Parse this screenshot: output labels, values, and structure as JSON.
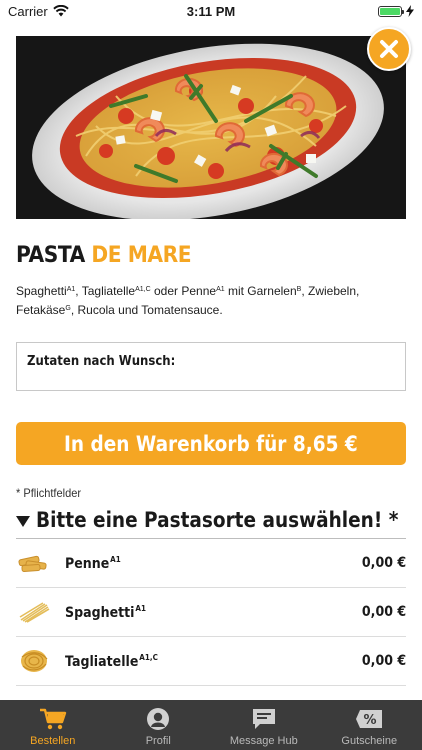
{
  "status_bar": {
    "carrier": "Carrier",
    "time": "3:11 PM"
  },
  "product": {
    "title_main": "PASTA ",
    "title_accent": "DE MARE",
    "desc": {
      "t1": "Spaghetti",
      "s1": "A1",
      "t2": ", Tagliatelle",
      "s2": "A1,C",
      "t3": " oder Penne",
      "s3": "A1",
      "t4": " mit Garnelen",
      "s4": "B",
      "t5": ", Zwiebeln, Fetakäse",
      "s5": "G",
      "t6": ", Rucola und Tomatensauce."
    }
  },
  "wishes_label": "Zutaten nach Wunsch:",
  "cart_button": "In den Warenkorb für 8,65 €",
  "required_note": "* Pflichtfelder",
  "section_title": "Bitte eine Pastasorte auswählen! *",
  "options": [
    {
      "name": "Penne",
      "allergen": "A1",
      "price": "0,00 €"
    },
    {
      "name": "Spaghetti",
      "allergen": "A1",
      "price": "0,00 €"
    },
    {
      "name": "Tagliatelle",
      "allergen": "A1,C",
      "price": "0,00 €"
    }
  ],
  "tabs": [
    {
      "label": "Bestellen",
      "icon": "cart-icon",
      "active": true
    },
    {
      "label": "Profil",
      "icon": "profile-icon",
      "active": false
    },
    {
      "label": "Message Hub",
      "icon": "message-icon",
      "active": false
    },
    {
      "label": "Gutscheine",
      "icon": "voucher-icon",
      "active": false
    }
  ],
  "colors": {
    "accent": "#f5a623",
    "tab_bar": "#3b3b3b",
    "battery": "#4cd964"
  }
}
